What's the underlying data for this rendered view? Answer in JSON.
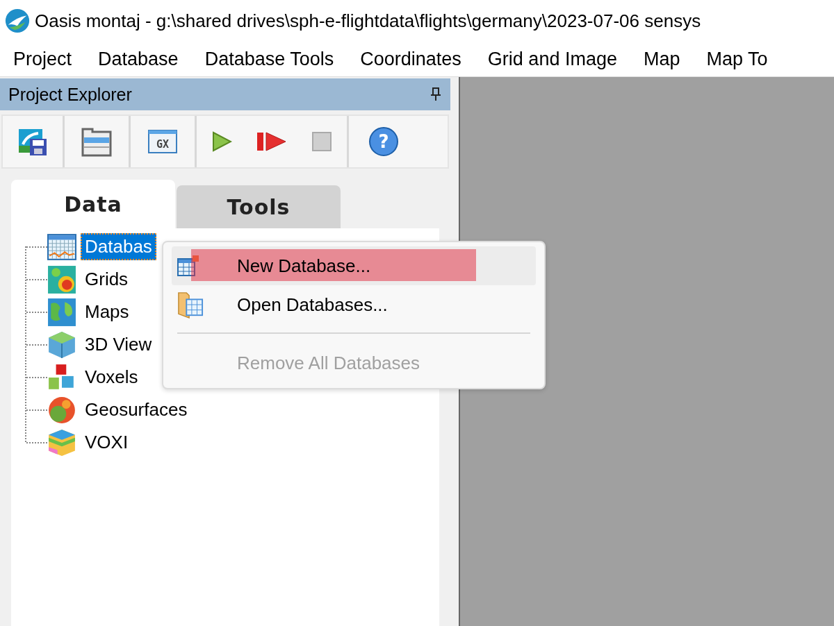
{
  "window": {
    "title": "Oasis montaj - g:\\shared drives\\sph-e-flightdata\\flights\\germany\\2023-07-06 sensys"
  },
  "menu_bar": [
    {
      "label": "Project"
    },
    {
      "label": "Database"
    },
    {
      "label": "Database Tools"
    },
    {
      "label": "Coordinates"
    },
    {
      "label": "Grid and Image"
    },
    {
      "label": "Map"
    },
    {
      "label": "Map To"
    }
  ],
  "project_explorer": {
    "title": "Project Explorer",
    "toolbar": [
      {
        "kind": "save"
      },
      {
        "kind": "explorer"
      },
      {
        "kind": "gx",
        "glyph": "GX"
      },
      {
        "kind": "run"
      },
      {
        "kind": "step"
      },
      {
        "kind": "stop",
        "disabled": true
      },
      {
        "kind": "help",
        "glyph": "?"
      }
    ],
    "tabs": [
      {
        "label": "Data",
        "selected": true
      },
      {
        "label": "Tools",
        "selected": false
      }
    ],
    "tree": [
      {
        "label": "Databas",
        "kind": "database",
        "selected": true
      },
      {
        "label": "Grids",
        "kind": "grids",
        "selected": false
      },
      {
        "label": "Maps",
        "kind": "maps",
        "selected": false
      },
      {
        "label": "3D View",
        "kind": "views3d",
        "selected": false
      },
      {
        "label": "Voxels",
        "kind": "voxels",
        "selected": false
      },
      {
        "label": "Geosurfaces",
        "kind": "geosurfaces",
        "selected": false
      },
      {
        "label": "VOXI",
        "kind": "voxi",
        "selected": false
      }
    ]
  },
  "context_menu": [
    {
      "kind": "item",
      "label": "New Database...",
      "highlighted": true,
      "disabled": false
    },
    {
      "kind": "item",
      "label": "Open Databases...",
      "highlighted": false,
      "disabled": false
    },
    {
      "kind": "separator"
    },
    {
      "kind": "item",
      "label": "Remove All Databases",
      "highlighted": false,
      "disabled": true
    }
  ]
}
